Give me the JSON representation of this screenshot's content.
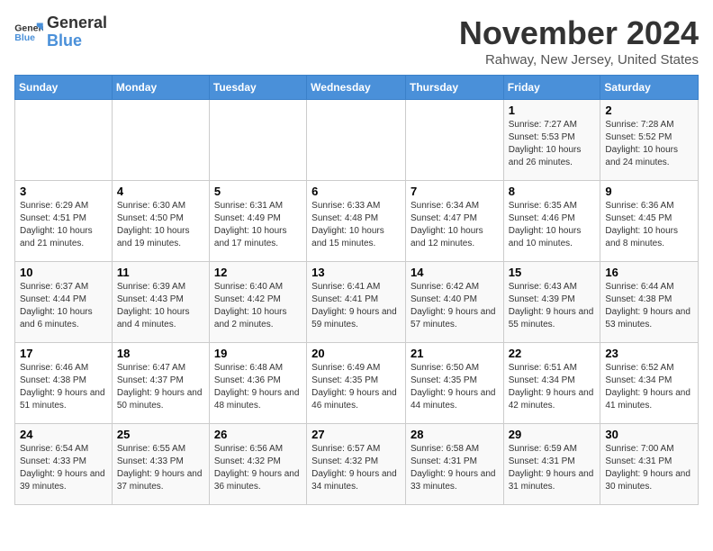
{
  "app": {
    "name": "GeneralBlue",
    "logo_text_line1": "General",
    "logo_text_line2": "Blue"
  },
  "calendar": {
    "month_title": "November 2024",
    "location": "Rahway, New Jersey, United States",
    "days_of_week": [
      "Sunday",
      "Monday",
      "Tuesday",
      "Wednesday",
      "Thursday",
      "Friday",
      "Saturday"
    ],
    "weeks": [
      [
        {
          "day": "",
          "info": ""
        },
        {
          "day": "",
          "info": ""
        },
        {
          "day": "",
          "info": ""
        },
        {
          "day": "",
          "info": ""
        },
        {
          "day": "",
          "info": ""
        },
        {
          "day": "1",
          "info": "Sunrise: 7:27 AM\nSunset: 5:53 PM\nDaylight: 10 hours and 26 minutes."
        },
        {
          "day": "2",
          "info": "Sunrise: 7:28 AM\nSunset: 5:52 PM\nDaylight: 10 hours and 24 minutes."
        }
      ],
      [
        {
          "day": "3",
          "info": "Sunrise: 6:29 AM\nSunset: 4:51 PM\nDaylight: 10 hours and 21 minutes."
        },
        {
          "day": "4",
          "info": "Sunrise: 6:30 AM\nSunset: 4:50 PM\nDaylight: 10 hours and 19 minutes."
        },
        {
          "day": "5",
          "info": "Sunrise: 6:31 AM\nSunset: 4:49 PM\nDaylight: 10 hours and 17 minutes."
        },
        {
          "day": "6",
          "info": "Sunrise: 6:33 AM\nSunset: 4:48 PM\nDaylight: 10 hours and 15 minutes."
        },
        {
          "day": "7",
          "info": "Sunrise: 6:34 AM\nSunset: 4:47 PM\nDaylight: 10 hours and 12 minutes."
        },
        {
          "day": "8",
          "info": "Sunrise: 6:35 AM\nSunset: 4:46 PM\nDaylight: 10 hours and 10 minutes."
        },
        {
          "day": "9",
          "info": "Sunrise: 6:36 AM\nSunset: 4:45 PM\nDaylight: 10 hours and 8 minutes."
        }
      ],
      [
        {
          "day": "10",
          "info": "Sunrise: 6:37 AM\nSunset: 4:44 PM\nDaylight: 10 hours and 6 minutes."
        },
        {
          "day": "11",
          "info": "Sunrise: 6:39 AM\nSunset: 4:43 PM\nDaylight: 10 hours and 4 minutes."
        },
        {
          "day": "12",
          "info": "Sunrise: 6:40 AM\nSunset: 4:42 PM\nDaylight: 10 hours and 2 minutes."
        },
        {
          "day": "13",
          "info": "Sunrise: 6:41 AM\nSunset: 4:41 PM\nDaylight: 9 hours and 59 minutes."
        },
        {
          "day": "14",
          "info": "Sunrise: 6:42 AM\nSunset: 4:40 PM\nDaylight: 9 hours and 57 minutes."
        },
        {
          "day": "15",
          "info": "Sunrise: 6:43 AM\nSunset: 4:39 PM\nDaylight: 9 hours and 55 minutes."
        },
        {
          "day": "16",
          "info": "Sunrise: 6:44 AM\nSunset: 4:38 PM\nDaylight: 9 hours and 53 minutes."
        }
      ],
      [
        {
          "day": "17",
          "info": "Sunrise: 6:46 AM\nSunset: 4:38 PM\nDaylight: 9 hours and 51 minutes."
        },
        {
          "day": "18",
          "info": "Sunrise: 6:47 AM\nSunset: 4:37 PM\nDaylight: 9 hours and 50 minutes."
        },
        {
          "day": "19",
          "info": "Sunrise: 6:48 AM\nSunset: 4:36 PM\nDaylight: 9 hours and 48 minutes."
        },
        {
          "day": "20",
          "info": "Sunrise: 6:49 AM\nSunset: 4:35 PM\nDaylight: 9 hours and 46 minutes."
        },
        {
          "day": "21",
          "info": "Sunrise: 6:50 AM\nSunset: 4:35 PM\nDaylight: 9 hours and 44 minutes."
        },
        {
          "day": "22",
          "info": "Sunrise: 6:51 AM\nSunset: 4:34 PM\nDaylight: 9 hours and 42 minutes."
        },
        {
          "day": "23",
          "info": "Sunrise: 6:52 AM\nSunset: 4:34 PM\nDaylight: 9 hours and 41 minutes."
        }
      ],
      [
        {
          "day": "24",
          "info": "Sunrise: 6:54 AM\nSunset: 4:33 PM\nDaylight: 9 hours and 39 minutes."
        },
        {
          "day": "25",
          "info": "Sunrise: 6:55 AM\nSunset: 4:33 PM\nDaylight: 9 hours and 37 minutes."
        },
        {
          "day": "26",
          "info": "Sunrise: 6:56 AM\nSunset: 4:32 PM\nDaylight: 9 hours and 36 minutes."
        },
        {
          "day": "27",
          "info": "Sunrise: 6:57 AM\nSunset: 4:32 PM\nDaylight: 9 hours and 34 minutes."
        },
        {
          "day": "28",
          "info": "Sunrise: 6:58 AM\nSunset: 4:31 PM\nDaylight: 9 hours and 33 minutes."
        },
        {
          "day": "29",
          "info": "Sunrise: 6:59 AM\nSunset: 4:31 PM\nDaylight: 9 hours and 31 minutes."
        },
        {
          "day": "30",
          "info": "Sunrise: 7:00 AM\nSunset: 4:31 PM\nDaylight: 9 hours and 30 minutes."
        }
      ]
    ]
  }
}
